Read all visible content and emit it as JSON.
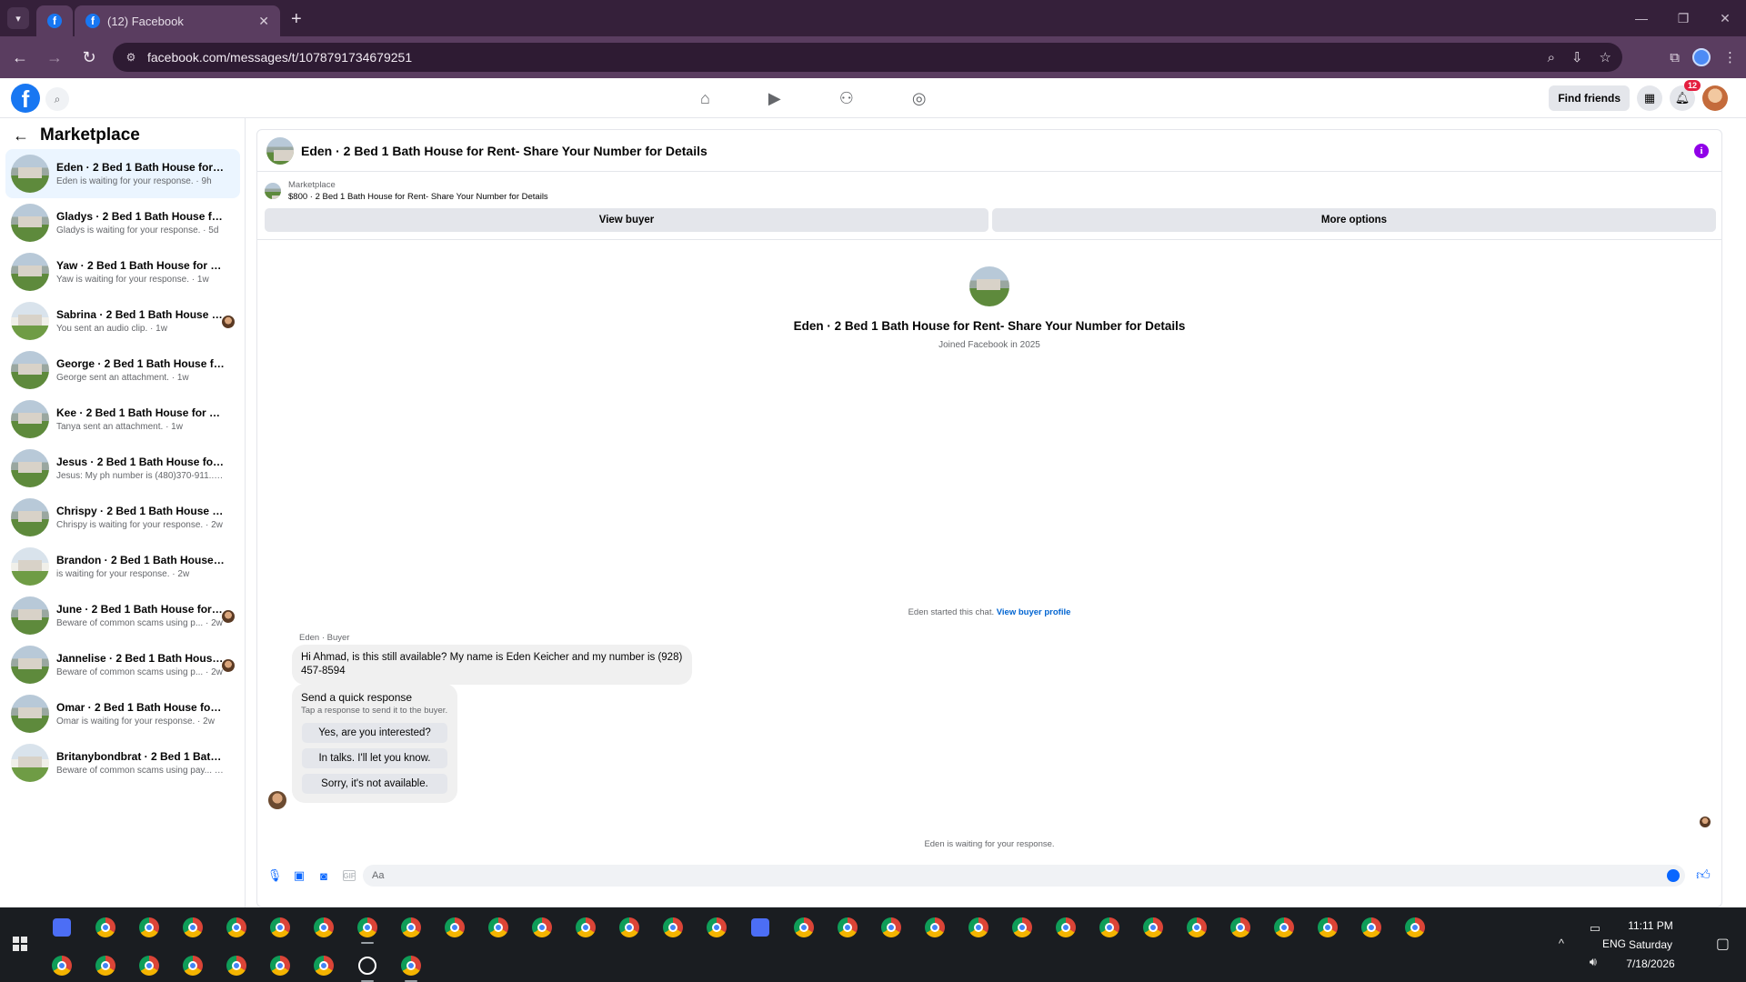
{
  "browser": {
    "tab_title": "(12) Facebook",
    "url": "facebook.com/messages/t/1078791734679251"
  },
  "fb": {
    "find_friends": "Find friends",
    "notif_count": "12"
  },
  "sidebar": {
    "title": "Marketplace",
    "conversations": [
      {
        "name": "Eden · 2 Bed 1 Bath House for Rent...",
        "sub": "Eden is waiting for your response. · 9h"
      },
      {
        "name": "Gladys · 2 Bed 1 Bath House for Re...",
        "sub": "Gladys is waiting for your response. · 5d"
      },
      {
        "name": "Yaw · 2 Bed 1 Bath House for Rent-...",
        "sub": "Yaw is waiting for your response. · 1w"
      },
      {
        "name": "Sabrina · 2 Bed 1 Bath House for...",
        "sub": "You sent an audio clip. · 1w"
      },
      {
        "name": "George · 2 Bed 1 Bath House for R...",
        "sub": "George sent an attachment. · 1w"
      },
      {
        "name": "Kee · 2 Bed 1 Bath House for Rent-...",
        "sub": "Tanya sent an attachment. · 1w"
      },
      {
        "name": "Jesus · 2 Bed 1 Bath House for Ren...",
        "sub": "Jesus: My ph number is (480)370-911... · 2w"
      },
      {
        "name": "Chrispy · 2 Bed 1 Bath House for R...",
        "sub": "Chrispy is waiting for your response. · 2w"
      },
      {
        "name": "Brandon · 2 Bed 1 Bath House for ...",
        "sub": "is waiting for your response. · 2w"
      },
      {
        "name": "June · 2 Bed 1 Bath House for Re...",
        "sub": "Beware of common scams using p... · 2w"
      },
      {
        "name": "Jannelise · 2 Bed 1 Bath House f...",
        "sub": "Beware of common scams using p... · 2w"
      },
      {
        "name": "Omar · 2 Bed 1 Bath House for Ren...",
        "sub": "Omar is waiting for your response. · 2w"
      },
      {
        "name": "Britanybondbrat · 2 Bed 1 Bath Ho...",
        "sub": "Beware of common scams using pay... · 3w"
      }
    ]
  },
  "chat": {
    "header_title": "Eden · 2 Bed 1 Bath House for Rent- Share Your Number for Details",
    "marketplace_label": "Marketplace",
    "listing": "$800 · 2 Bed 1 Bath House for Rent- Share Your Number for Details",
    "view_buyer": "View buyer",
    "more_options": "More options",
    "profile_name": "Eden · 2 Bed 1 Bath House for Rent- Share Your Number for Details",
    "profile_joined": "Joined Facebook in 2025",
    "started_text": "Eden started this chat.",
    "view_buyer_profile": "View buyer profile",
    "sender_label": "Eden · Buyer",
    "message": "Hi Ahmad, is this still available? My name is Eden Keicher and my number is (928) 457-8594",
    "quick_title": "Send a quick response",
    "quick_sub": "Tap a response to send it to the buyer.",
    "quick_options": [
      "Yes, are you interested?",
      "In talks. I'll let you know.",
      "Sorry, it's not available."
    ],
    "waiting": "Eden is waiting for your response.",
    "composer_placeholder": "Aa"
  },
  "taskbar": {
    "time": "11:11 PM",
    "day": "Saturday",
    "date": "7/18/2026",
    "lang": "ENG"
  }
}
